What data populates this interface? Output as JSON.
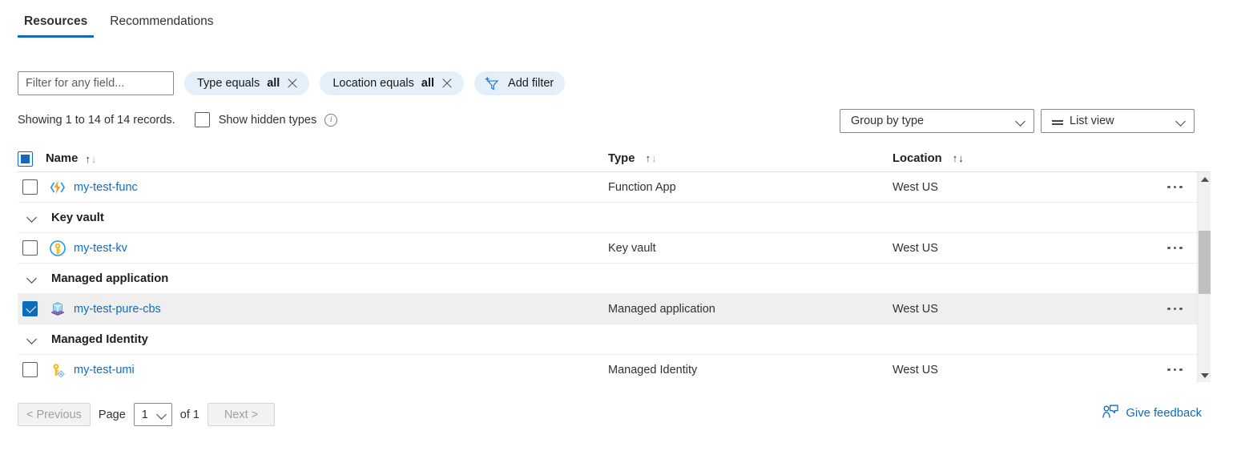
{
  "tabs": [
    {
      "label": "Resources",
      "active": true
    },
    {
      "label": "Recommendations",
      "active": false
    }
  ],
  "filterbar": {
    "search_placeholder": "Filter for any field...",
    "search_value": "",
    "pills": [
      {
        "prefix": "Type equals",
        "value": "all"
      },
      {
        "prefix": "Location equals",
        "value": "all"
      }
    ],
    "add_filter_label": "Add filter"
  },
  "summary": {
    "records_text": "Showing 1 to 14 of 14 records.",
    "show_hidden_label": "Show hidden types",
    "show_hidden_checked": false,
    "info_glyph": "i"
  },
  "view_controls": {
    "group_by": "Group by type",
    "view_mode": "List view"
  },
  "table": {
    "columns": {
      "name": "Name",
      "type": "Type",
      "location": "Location"
    },
    "select_all_state": "indeterminate",
    "rows": [
      {
        "kind": "resource",
        "name": "my-test-func",
        "type": "Function App",
        "location": "West US",
        "icon": "function-app-icon",
        "selected": false,
        "partial": true
      },
      {
        "kind": "group",
        "name": "Key vault"
      },
      {
        "kind": "resource",
        "name": "my-test-kv",
        "type": "Key vault",
        "location": "West US",
        "icon": "key-vault-icon",
        "selected": false
      },
      {
        "kind": "group",
        "name": "Managed application"
      },
      {
        "kind": "resource",
        "name": "my-test-pure-cbs",
        "type": "Managed application",
        "location": "West US",
        "icon": "managed-application-icon",
        "selected": true
      },
      {
        "kind": "group",
        "name": "Managed Identity"
      },
      {
        "kind": "resource",
        "name": "my-test-umi",
        "type": "Managed Identity",
        "location": "West US",
        "icon": "managed-identity-icon",
        "selected": false
      }
    ],
    "row_menu_label": "..."
  },
  "pagination": {
    "previous_label": "< Previous",
    "next_label": "Next >",
    "page_label": "Page",
    "page_value": "1",
    "of_label": "of 1"
  },
  "feedback": {
    "label": "Give feedback"
  },
  "colors": {
    "accent": "#0f6cbd",
    "link": "#0f6cbd",
    "pill_bg": "#e5eff9",
    "selected_row_bg": "#efefef",
    "scrollbar_thumb": "#c0c0c0"
  }
}
